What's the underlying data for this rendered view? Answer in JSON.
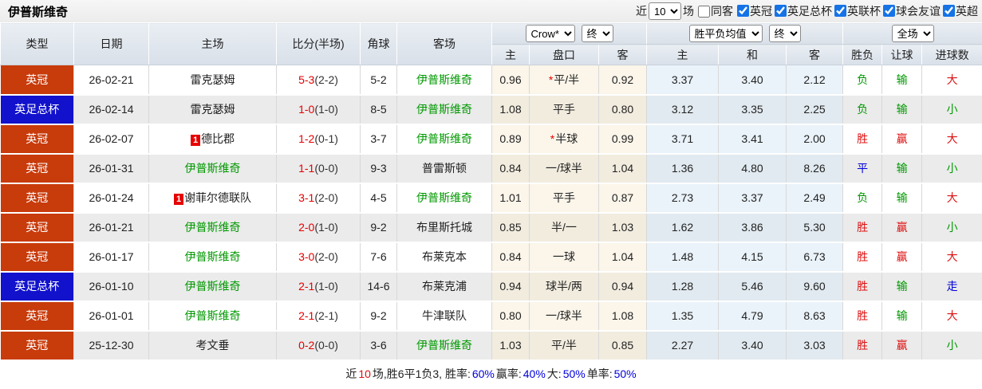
{
  "toolbar": {
    "title": "伊普斯维奇",
    "recent_label": "近",
    "recent_value": "10",
    "matches_label": "场",
    "same_away": {
      "label": "同客",
      "checked": false
    },
    "leagues": [
      {
        "label": "英冠",
        "checked": true
      },
      {
        "label": "英足总杯",
        "checked": true
      },
      {
        "label": "英联杯",
        "checked": true
      },
      {
        "label": "球会友谊",
        "checked": true
      },
      {
        "label": "英超",
        "checked": true
      }
    ]
  },
  "table": {
    "headers": {
      "type": "类型",
      "date": "日期",
      "home": "主场",
      "score": "比分(半场)",
      "corner": "角球",
      "away": "客场",
      "odds_home": "主",
      "odds_handicap": "盘口",
      "odds_away": "客",
      "mean_home": "主",
      "mean_draw": "和",
      "mean_away": "客",
      "wdl": "胜负",
      "handicap_result": "让球",
      "goals": "进球数"
    },
    "dropdowns": {
      "bookmaker": "Crow*",
      "bookmaker_state": "终",
      "mean_label": "胜平负均值",
      "mean_state": "终",
      "scope": "全场"
    },
    "rows": [
      {
        "league": {
          "text": "英冠",
          "style": "red"
        },
        "date": "26-02-21",
        "home": {
          "text": "雷克瑟姆",
          "highlight": false,
          "badge": ""
        },
        "score": {
          "full": "5-3",
          "half": "(2-2)"
        },
        "corner": "5-2",
        "away": {
          "text": "伊普斯维奇",
          "highlight": true,
          "badge": ""
        },
        "odds_home": "0.96",
        "handicap": {
          "star": true,
          "text": "平/半"
        },
        "odds_away": "0.92",
        "mean": [
          "3.37",
          "3.40",
          "2.12"
        ],
        "wdl": {
          "text": "负",
          "color": "green"
        },
        "rq": {
          "text": "输",
          "color": "green"
        },
        "goal": {
          "text": "大",
          "color": "red"
        }
      },
      {
        "league": {
          "text": "英足总杯",
          "style": "blue"
        },
        "date": "26-02-14",
        "home": {
          "text": "雷克瑟姆",
          "highlight": false,
          "badge": ""
        },
        "score": {
          "full": "1-0",
          "half": "(1-0)"
        },
        "corner": "8-5",
        "away": {
          "text": "伊普斯维奇",
          "highlight": true,
          "badge": ""
        },
        "odds_home": "1.08",
        "handicap": {
          "star": false,
          "text": "平手"
        },
        "odds_away": "0.80",
        "mean": [
          "3.12",
          "3.35",
          "2.25"
        ],
        "wdl": {
          "text": "负",
          "color": "green"
        },
        "rq": {
          "text": "输",
          "color": "green"
        },
        "goal": {
          "text": "小",
          "color": "green"
        }
      },
      {
        "league": {
          "text": "英冠",
          "style": "red"
        },
        "date": "26-02-07",
        "home": {
          "text": "德比郡",
          "highlight": false,
          "badge": "1"
        },
        "score": {
          "full": "1-2",
          "half": "(0-1)"
        },
        "corner": "3-7",
        "away": {
          "text": "伊普斯维奇",
          "highlight": true,
          "badge": ""
        },
        "odds_home": "0.89",
        "handicap": {
          "star": true,
          "text": "半球"
        },
        "odds_away": "0.99",
        "mean": [
          "3.71",
          "3.41",
          "2.00"
        ],
        "wdl": {
          "text": "胜",
          "color": "red"
        },
        "rq": {
          "text": "赢",
          "color": "red"
        },
        "goal": {
          "text": "大",
          "color": "red"
        }
      },
      {
        "league": {
          "text": "英冠",
          "style": "red"
        },
        "date": "26-01-31",
        "home": {
          "text": "伊普斯维奇",
          "highlight": true,
          "badge": ""
        },
        "score": {
          "full": "1-1",
          "half": "(0-0)"
        },
        "corner": "9-3",
        "away": {
          "text": "普雷斯顿",
          "highlight": false,
          "badge": ""
        },
        "odds_home": "0.84",
        "handicap": {
          "star": false,
          "text": "一/球半"
        },
        "odds_away": "1.04",
        "mean": [
          "1.36",
          "4.80",
          "8.26"
        ],
        "wdl": {
          "text": "平",
          "color": "blue"
        },
        "rq": {
          "text": "输",
          "color": "green"
        },
        "goal": {
          "text": "小",
          "color": "green"
        }
      },
      {
        "league": {
          "text": "英冠",
          "style": "red"
        },
        "date": "26-01-24",
        "home": {
          "text": "谢菲尔德联队",
          "highlight": false,
          "badge": "1"
        },
        "score": {
          "full": "3-1",
          "half": "(2-0)"
        },
        "corner": "4-5",
        "away": {
          "text": "伊普斯维奇",
          "highlight": true,
          "badge": ""
        },
        "odds_home": "1.01",
        "handicap": {
          "star": false,
          "text": "平手"
        },
        "odds_away": "0.87",
        "mean": [
          "2.73",
          "3.37",
          "2.49"
        ],
        "wdl": {
          "text": "负",
          "color": "green"
        },
        "rq": {
          "text": "输",
          "color": "green"
        },
        "goal": {
          "text": "大",
          "color": "red"
        }
      },
      {
        "league": {
          "text": "英冠",
          "style": "red"
        },
        "date": "26-01-21",
        "home": {
          "text": "伊普斯维奇",
          "highlight": true,
          "badge": ""
        },
        "score": {
          "full": "2-0",
          "half": "(1-0)"
        },
        "corner": "9-2",
        "away": {
          "text": "布里斯托城",
          "highlight": false,
          "badge": ""
        },
        "odds_home": "0.85",
        "handicap": {
          "star": false,
          "text": "半/一"
        },
        "odds_away": "1.03",
        "mean": [
          "1.62",
          "3.86",
          "5.30"
        ],
        "wdl": {
          "text": "胜",
          "color": "red"
        },
        "rq": {
          "text": "赢",
          "color": "red"
        },
        "goal": {
          "text": "小",
          "color": "green"
        }
      },
      {
        "league": {
          "text": "英冠",
          "style": "red"
        },
        "date": "26-01-17",
        "home": {
          "text": "伊普斯维奇",
          "highlight": true,
          "badge": ""
        },
        "score": {
          "full": "3-0",
          "half": "(2-0)"
        },
        "corner": "7-6",
        "away": {
          "text": "布莱克本",
          "highlight": false,
          "badge": ""
        },
        "odds_home": "0.84",
        "handicap": {
          "star": false,
          "text": "一球"
        },
        "odds_away": "1.04",
        "mean": [
          "1.48",
          "4.15",
          "6.73"
        ],
        "wdl": {
          "text": "胜",
          "color": "red"
        },
        "rq": {
          "text": "赢",
          "color": "red"
        },
        "goal": {
          "text": "大",
          "color": "red"
        }
      },
      {
        "league": {
          "text": "英足总杯",
          "style": "blue"
        },
        "date": "26-01-10",
        "home": {
          "text": "伊普斯维奇",
          "highlight": true,
          "badge": ""
        },
        "score": {
          "full": "2-1",
          "half": "(1-0)"
        },
        "corner": "14-6",
        "away": {
          "text": "布莱克浦",
          "highlight": false,
          "badge": ""
        },
        "odds_home": "0.94",
        "handicap": {
          "star": false,
          "text": "球半/两"
        },
        "odds_away": "0.94",
        "mean": [
          "1.28",
          "5.46",
          "9.60"
        ],
        "wdl": {
          "text": "胜",
          "color": "red"
        },
        "rq": {
          "text": "输",
          "color": "green"
        },
        "goal": {
          "text": "走",
          "color": "blue"
        }
      },
      {
        "league": {
          "text": "英冠",
          "style": "red"
        },
        "date": "26-01-01",
        "home": {
          "text": "伊普斯维奇",
          "highlight": true,
          "badge": ""
        },
        "score": {
          "full": "2-1",
          "half": "(2-1)"
        },
        "corner": "9-2",
        "away": {
          "text": "牛津联队",
          "highlight": false,
          "badge": ""
        },
        "odds_home": "0.80",
        "handicap": {
          "star": false,
          "text": "一/球半"
        },
        "odds_away": "1.08",
        "mean": [
          "1.35",
          "4.79",
          "8.63"
        ],
        "wdl": {
          "text": "胜",
          "color": "red"
        },
        "rq": {
          "text": "输",
          "color": "green"
        },
        "goal": {
          "text": "大",
          "color": "red"
        }
      },
      {
        "league": {
          "text": "英冠",
          "style": "red"
        },
        "date": "25-12-30",
        "home": {
          "text": "考文垂",
          "highlight": false,
          "badge": ""
        },
        "score": {
          "full": "0-2",
          "half": "(0-0)"
        },
        "corner": "3-6",
        "away": {
          "text": "伊普斯维奇",
          "highlight": true,
          "badge": ""
        },
        "odds_home": "1.03",
        "handicap": {
          "star": false,
          "text": "平/半"
        },
        "odds_away": "0.85",
        "mean": [
          "2.27",
          "3.40",
          "3.03"
        ],
        "wdl": {
          "text": "胜",
          "color": "red"
        },
        "rq": {
          "text": "赢",
          "color": "red"
        },
        "goal": {
          "text": "小",
          "color": "green"
        }
      }
    ]
  },
  "footer": {
    "segments": [
      {
        "text": "近",
        "color": "black"
      },
      {
        "text": "10",
        "color": "red"
      },
      {
        "text": "场,胜6平1负3, 胜率:",
        "color": "black"
      },
      {
        "text": "60%",
        "color": "blue"
      },
      {
        "text": " 赢率:",
        "color": "black"
      },
      {
        "text": "40%",
        "color": "blue"
      },
      {
        "text": " 大:",
        "color": "black"
      },
      {
        "text": "50%",
        "color": "blue"
      },
      {
        "text": " 单率:",
        "color": "black"
      },
      {
        "text": "50%",
        "color": "blue"
      }
    ]
  },
  "colors": {
    "league_red": "#c83b0b",
    "league_blue": "#1212cd",
    "score_red": "#e60000",
    "team_green": "#009900",
    "result_red": "#dd1111",
    "result_green": "#009900",
    "result_blue": "#0000dd"
  }
}
